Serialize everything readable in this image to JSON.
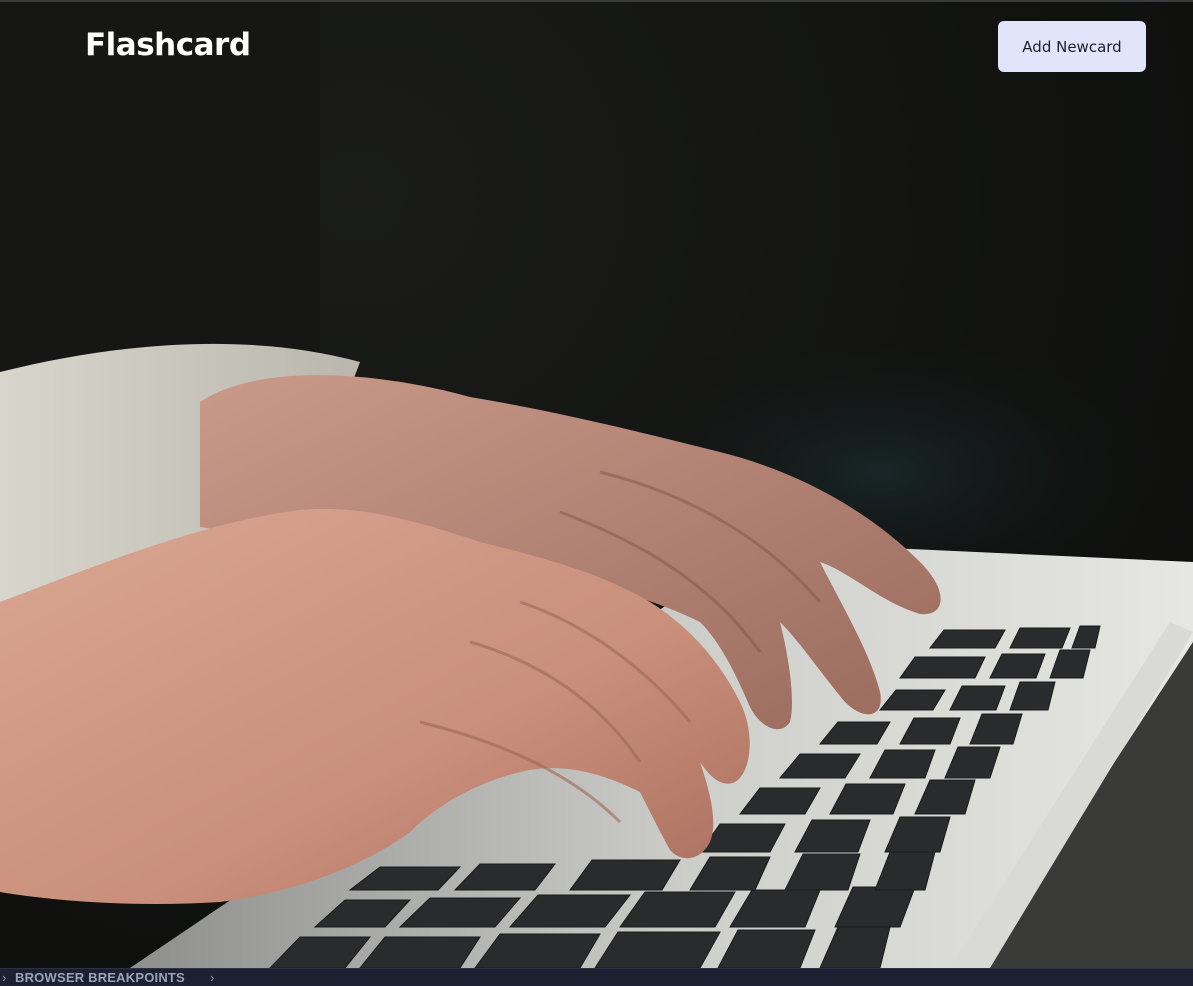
{
  "app": {
    "brand": "Flashcard"
  },
  "header": {
    "add_button_label": "Add Newcard"
  },
  "hero": {
    "image_description_icon": "hands-typing-on-laptop-photo"
  },
  "devtools_bar": {
    "label": "BROWSER BREAKPOINTS"
  },
  "colors": {
    "brand_text": "#ffffff",
    "button_bg": "#e1e4fb",
    "button_text": "#1e1f26",
    "devbar_bg": "#1c2030",
    "devbar_text": "#9aa3bd"
  }
}
